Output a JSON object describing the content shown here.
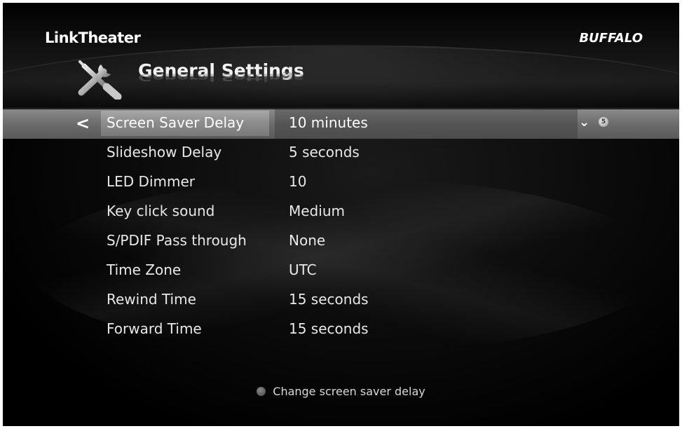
{
  "header": {
    "brand_left": "LinkTheater",
    "brand_right": "BUFFALO",
    "title": "General Settings"
  },
  "settings": [
    {
      "label": "Screen Saver Delay",
      "value": "10 minutes",
      "selected": true
    },
    {
      "label": "Slideshow Delay",
      "value": "5 seconds"
    },
    {
      "label": "LED Dimmer",
      "value": "10"
    },
    {
      "label": "Key click sound",
      "value": "Medium"
    },
    {
      "label": "S/PDIF Pass through",
      "value": "None"
    },
    {
      "label": "Time Zone",
      "value": "UTC"
    },
    {
      "label": "Rewind Time",
      "value": "15 seconds"
    },
    {
      "label": "Forward Time",
      "value": "15 seconds"
    }
  ],
  "nav": {
    "left_arrow": "<",
    "down_arrow": "⌄",
    "button_glyph": "⑤"
  },
  "footer": {
    "hint": "Change screen saver delay"
  },
  "colors": {
    "background": "#000000",
    "text": "#e8e8e8",
    "selection": "#7a7a7a"
  }
}
